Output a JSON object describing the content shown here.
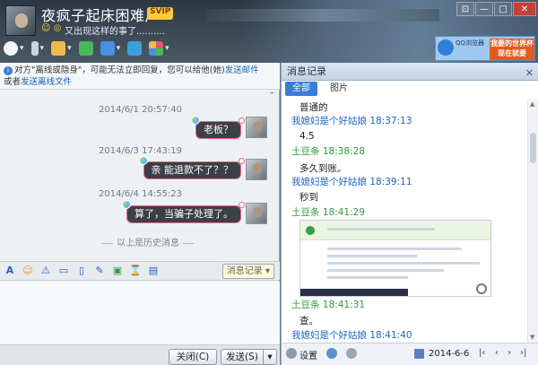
{
  "header": {
    "contact_name": "夜疯子起床困难户",
    "vip_badge": "SVIP",
    "status_icons": "☺ ◎",
    "signature": "又出现这样的事了..........",
    "window_controls": [
      "⊡",
      "—",
      "□",
      "✕"
    ],
    "toolbar": [
      {
        "icon": "video-call-icon",
        "color": "#ffffff"
      },
      {
        "icon": "voice-call-icon",
        "color": "#c9d6e0"
      },
      {
        "icon": "send-file-icon",
        "color": "#f2b84b"
      },
      {
        "icon": "group-add-icon",
        "color": "#48b85a"
      },
      {
        "icon": "remote-desktop-icon",
        "color": "#4a8fe0"
      },
      {
        "icon": "screen-share-icon",
        "color": "#3aa0d8"
      },
      {
        "icon": "apps-icon",
        "color": "#e0566a"
      }
    ]
  },
  "ad": {
    "browser_label": "QQ浏览器",
    "promo_text": "我要的世界杯 现在就要"
  },
  "notice": {
    "text_1": "对方\"离线或隐身\"，可能无法立即回复，您可以给他(她)",
    "link_1": "发送邮件",
    "text_2": "或者",
    "link_2": "发送离线文件"
  },
  "messages": [
    {
      "time": "2014/6/1 20:57:40",
      "text": "老板？"
    },
    {
      "time": "2014/6/3 17:43:19",
      "text": "亲 能退款不了？？"
    },
    {
      "time": "2014/6/4 14:55:23",
      "text": "算了，当骗子处理了。"
    }
  ],
  "history_end_text": "以上是历史消息",
  "chat_toolbar": {
    "tools": [
      "A",
      "☺",
      "⚠",
      "▭",
      "▯",
      "✎",
      "▣",
      "⌛",
      "▤"
    ],
    "history_button": "消息记录 ▾"
  },
  "buttons": {
    "close": "关闭(C)",
    "send": "发送(S)",
    "send_dropdown": "▾"
  },
  "history_panel": {
    "title": "消息记录",
    "close_icon": "✕",
    "tabs": [
      "全部",
      "图片"
    ],
    "entries": [
      {
        "kind": "text",
        "content": "普通的"
      },
      {
        "kind": "me",
        "content": "我媳妇是个好姑娘 18:37:13"
      },
      {
        "kind": "text",
        "content": "4.5"
      },
      {
        "kind": "other",
        "content": "土豆条 18:38:28"
      },
      {
        "kind": "text",
        "content": "多久到账。"
      },
      {
        "kind": "me",
        "content": "我媳妇是个好姑娘 18:39:11"
      },
      {
        "kind": "text",
        "content": "秒到"
      },
      {
        "kind": "other",
        "content": "土豆条 18:41:29"
      },
      {
        "kind": "other",
        "content": "土豆条 18:41:31"
      },
      {
        "kind": "text",
        "content": "查。"
      },
      {
        "kind": "me",
        "content": "我媳妇是个好姑娘 18:41:40"
      }
    ],
    "footer": {
      "settings": "设置",
      "date": "2014-6-6",
      "nav": [
        "|‹",
        "‹",
        "›",
        "›|"
      ]
    }
  }
}
